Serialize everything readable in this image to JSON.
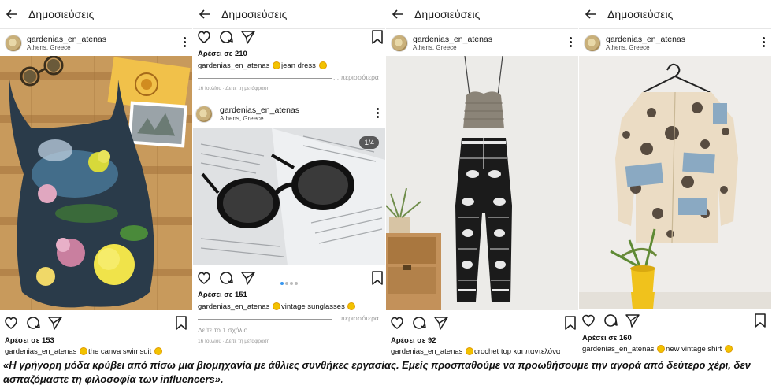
{
  "panels": [
    {
      "topbar_title": "Δημοσιεύσεις",
      "username": "gardenias_en_atenas",
      "location": "Athens, Greece",
      "likes": "Αρέσει σε 153",
      "caption_user": "gardenias_en_atenas",
      "caption_text": "the canva swimsuit"
    },
    {
      "topbar_title": "Δημοσιεύσεις",
      "prev_likes": "Αρέσει σε 210",
      "prev_caption_user": "gardenias_en_atenas",
      "prev_caption_text": "jean dress",
      "prev_more": "... περισσότερα",
      "prev_date": "16 Ιουλίου · Δείτε τη μετάφραση",
      "username": "gardenias_en_atenas",
      "location": "Athens, Greece",
      "counter": "1/4",
      "likes": "Αρέσει σε 151",
      "caption_user": "gardenias_en_atenas",
      "caption_text": "vintage sunglasses",
      "more": "... περισσότερα",
      "comments": "Δείτε το 1 σχόλιο",
      "date": "16 Ιουλίου · Δείτε τη μετάφραση"
    },
    {
      "topbar_title": "Δημοσιεύσεις",
      "username": "gardenias_en_atenas",
      "location": "Athens, Greece",
      "likes": "Αρέσει σε 92",
      "caption_user": "gardenias_en_atenas",
      "caption_text": "crochet top και παντελόνα"
    },
    {
      "topbar_title": "Δημοσιεύσεις",
      "username": "gardenias_en_atenas",
      "location": "Athens, Greece",
      "likes": "Αρέσει σε 160",
      "caption_user": "gardenias_en_atenas",
      "caption_text": "new vintage shirt"
    }
  ],
  "footer_text": "«Η γρήγορη μόδα κρύβει από πίσω μια βιομηχανία με άθλιες συνθήκες εργασίας. Εμείς προσπαθούμε να προωθήσουμε την αγορά από δεύτερο χέρι, δεν ασπαζόμαστε τη φιλοσοφία των influencers».",
  "icons": [
    "back-arrow-icon",
    "more-icon",
    "heart-icon",
    "comment-icon",
    "share-icon",
    "bookmark-icon",
    "sunflower-emoji-icon"
  ],
  "colors": {
    "text": "#262626",
    "muted": "#999999",
    "carousel_active": "#3897f0"
  }
}
